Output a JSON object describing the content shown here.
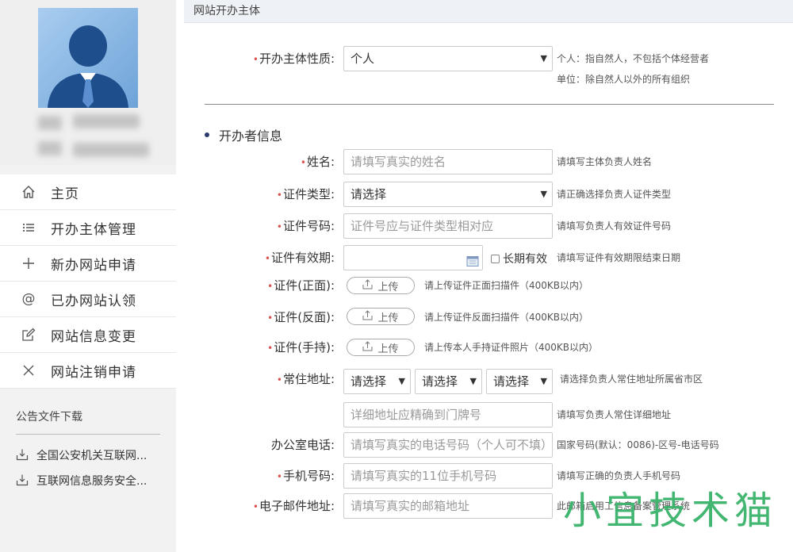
{
  "sidebar": {
    "nav": [
      {
        "label": "主页",
        "icon": "home-icon"
      },
      {
        "label": "开办主体管理",
        "icon": "list-icon"
      },
      {
        "label": "新办网站申请",
        "icon": "plus-icon"
      },
      {
        "label": "已办网站认领",
        "icon": "at-icon"
      },
      {
        "label": "网站信息变更",
        "icon": "edit-icon"
      },
      {
        "label": "网站注销申请",
        "icon": "close-icon"
      }
    ],
    "notice_title": "公告文件下载",
    "docs": [
      {
        "label": "全国公安机关互联网..."
      },
      {
        "label": "互联网信息服务安全..."
      }
    ]
  },
  "topbar": {
    "title": "网站开办主体"
  },
  "form": {
    "nature": {
      "label": "开办主体性质:",
      "value": "个人",
      "hint1": "个人：指自然人，不包括个体经营者",
      "hint2": "单位：除自然人以外的所有组织"
    },
    "section_title": "开办者信息",
    "name": {
      "label": "姓名:",
      "placeholder": "请填写真实的姓名",
      "hint": "请填写主体负责人姓名"
    },
    "id_type": {
      "label": "证件类型:",
      "value": "请选择",
      "hint": "请正确选择负责人证件类型"
    },
    "id_number": {
      "label": "证件号码:",
      "placeholder": "证件号应与证件类型相对应",
      "hint": "请填写负责人有效证件号码"
    },
    "id_validity": {
      "label": "证件有效期:",
      "checkbox_label": "长期有效",
      "hint": "请填写证件有效期限结束日期"
    },
    "id_front": {
      "label": "证件(正面):",
      "button": "上传",
      "hint": "请上传证件正面扫描件（400KB以内）"
    },
    "id_back": {
      "label": "证件(反面):",
      "button": "上传",
      "hint": "请上传证件反面扫描件（400KB以内）"
    },
    "id_hold": {
      "label": "证件(手持):",
      "button": "上传",
      "hint": "请上传本人手持证件照片（400KB以内）"
    },
    "address": {
      "label": "常住地址:",
      "province": "请选择",
      "city": "请选择",
      "district": "请选择",
      "hint": "请选择负责人常住地址所属省市区",
      "detail_placeholder": "详细地址应精确到门牌号",
      "detail_hint": "请填写负责人常住详细地址"
    },
    "office_phone": {
      "label": "办公室电话:",
      "placeholder": "请填写真实的电话号码（个人可不填）",
      "hint": "国家号码(默认：0086)-区号-电话号码"
    },
    "mobile": {
      "label": "手机号码:",
      "placeholder": "请填写真实的11位手机号码",
      "hint": "请填写正确的负责人手机号码"
    },
    "email": {
      "label": "电子邮件地址:",
      "placeholder": "请填写真实的邮箱地址",
      "hint": "此邮箱启用工信息备案管理系统"
    }
  },
  "watermark": "小宜技术猫"
}
